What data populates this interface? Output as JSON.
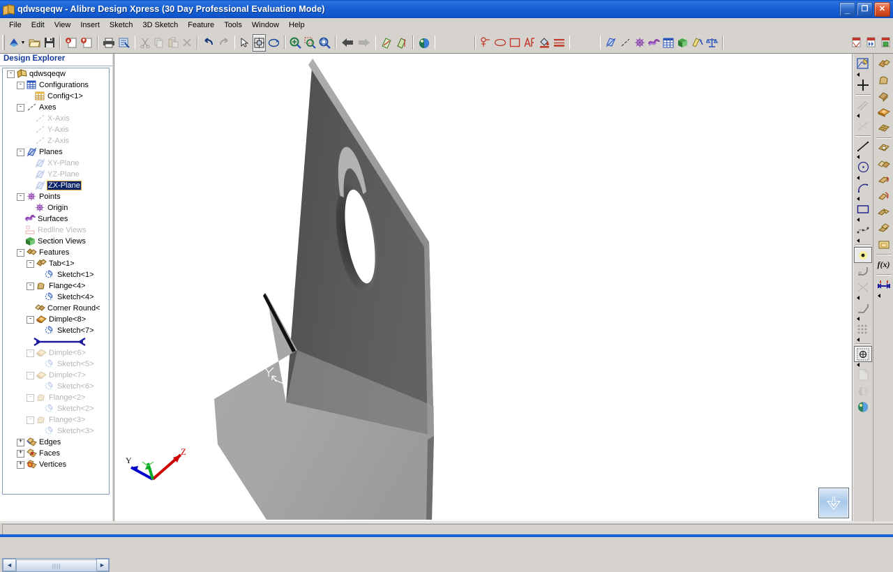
{
  "window": {
    "title": "qdwsqeqw - Alibre Design Xpress (30 Day Professional Evaluation Mode)",
    "app_icon": "part-document-icon",
    "minimize_label": "_",
    "restore_label": "❐",
    "close_label": "✕"
  },
  "menu": {
    "items": [
      {
        "label": "File"
      },
      {
        "label": "Edit"
      },
      {
        "label": "View"
      },
      {
        "label": "Insert"
      },
      {
        "label": "Sketch"
      },
      {
        "label": "3D Sketch"
      },
      {
        "label": "Feature"
      },
      {
        "label": "Tools"
      },
      {
        "label": "Window"
      },
      {
        "label": "Help"
      }
    ]
  },
  "toolbar": {
    "groups": [
      {
        "name": "file",
        "buttons": [
          {
            "icon": "new-document-icon",
            "label": "New",
            "dropdown": true
          },
          {
            "icon": "open-folder-icon",
            "label": "Open"
          },
          {
            "icon": "save-disk-icon",
            "label": "Save"
          }
        ]
      },
      {
        "name": "pack",
        "buttons": [
          {
            "icon": "pack-in-icon",
            "label": "Insert Package"
          },
          {
            "icon": "pack-out-icon",
            "label": "Extract Package"
          }
        ]
      },
      {
        "name": "print",
        "buttons": [
          {
            "icon": "print-icon",
            "label": "Print"
          },
          {
            "icon": "print-preview-icon",
            "label": "Print Preview"
          }
        ]
      },
      {
        "name": "clipboard",
        "buttons": [
          {
            "icon": "cut-scissors-icon",
            "label": "Cut",
            "disabled": true
          },
          {
            "icon": "copy-icon",
            "label": "Copy",
            "disabled": true
          },
          {
            "icon": "paste-icon",
            "label": "Paste",
            "disabled": true
          },
          {
            "icon": "delete-x-icon",
            "label": "Delete",
            "disabled": true
          }
        ]
      },
      {
        "name": "history",
        "buttons": [
          {
            "icon": "undo-arrow-icon",
            "label": "Undo"
          },
          {
            "icon": "redo-arrow-icon",
            "label": "Redo",
            "disabled": true
          }
        ]
      },
      {
        "name": "navigate",
        "buttons": [
          {
            "icon": "select-arrow-icon",
            "label": "Select"
          },
          {
            "icon": "pan-hand-icon",
            "label": "Pan",
            "active": true
          },
          {
            "icon": "rotate-icon",
            "label": "Rotate"
          }
        ]
      },
      {
        "name": "zoom",
        "buttons": [
          {
            "icon": "zoom-in-icon",
            "label": "Zoom In"
          },
          {
            "icon": "zoom-window-icon",
            "label": "Zoom Window"
          },
          {
            "icon": "zoom-fit-icon",
            "label": "Zoom To Fit"
          }
        ]
      },
      {
        "name": "view-history",
        "buttons": [
          {
            "icon": "previous-view-arrow-icon",
            "label": "Previous View"
          },
          {
            "icon": "next-view-arrow-icon",
            "label": "Next View",
            "disabled": true
          }
        ]
      },
      {
        "name": "display",
        "buttons": [
          {
            "icon": "sheet-metal-flat-icon",
            "label": "Flat Pattern"
          },
          {
            "icon": "sheet-metal-folded-icon",
            "label": "Folded Model"
          },
          {
            "icon": "render-globe-icon",
            "label": "Render Shading"
          }
        ]
      },
      {
        "name": "annotation",
        "buttons": [
          {
            "icon": "note-leader-icon",
            "label": "Note"
          },
          {
            "icon": "ellipse-annotation-icon",
            "label": "Ellipse"
          },
          {
            "icon": "rectangle-annotation-icon",
            "label": "Rectangle"
          },
          {
            "icon": "text-annotation-icon",
            "label": "Text"
          },
          {
            "icon": "fill-bucket-icon",
            "label": "Fill"
          },
          {
            "icon": "line-style-icon",
            "label": "Line Style"
          }
        ]
      },
      {
        "name": "reference",
        "buttons": [
          {
            "icon": "show-planes-icon",
            "label": "Show Planes"
          },
          {
            "icon": "show-axes-icon",
            "label": "Show Axes"
          },
          {
            "icon": "show-points-icon",
            "label": "Show Points"
          },
          {
            "icon": "show-surfaces-icon",
            "label": "Show Surfaces"
          },
          {
            "icon": "configurations-icon",
            "label": "Configurations"
          },
          {
            "icon": "section-view-icon",
            "label": "Section View"
          },
          {
            "icon": "measure-icon",
            "label": "Measure"
          },
          {
            "icon": "physical-properties-icon",
            "label": "Physical Properties"
          }
        ]
      },
      {
        "name": "publish",
        "buttons": [
          {
            "icon": "export-pdf-icon",
            "label": "Export PDF"
          },
          {
            "icon": "publish-3d-icon",
            "label": "Publish 3D"
          },
          {
            "icon": "capture-image-icon",
            "label": "Capture Image"
          }
        ]
      }
    ]
  },
  "explorer": {
    "header": "Design Explorer",
    "tree": [
      {
        "label": "qdwsqeqw",
        "depth": 0,
        "toggle": "-",
        "icon": "part-icon",
        "dim": false
      },
      {
        "label": "Configurations",
        "depth": 1,
        "toggle": "-",
        "icon": "configurations-icon",
        "dim": false
      },
      {
        "label": "Config<1>",
        "depth": 2,
        "toggle": "",
        "icon": "configuration-icon",
        "dim": false
      },
      {
        "label": "Axes",
        "depth": 1,
        "toggle": "-",
        "icon": "axis-icon",
        "dim": false
      },
      {
        "label": "X-Axis",
        "depth": 2,
        "toggle": "",
        "icon": "axis-icon",
        "dim": true
      },
      {
        "label": "Y-Axis",
        "depth": 2,
        "toggle": "",
        "icon": "axis-icon",
        "dim": true
      },
      {
        "label": "Z-Axis",
        "depth": 2,
        "toggle": "",
        "icon": "axis-icon",
        "dim": true
      },
      {
        "label": "Planes",
        "depth": 1,
        "toggle": "-",
        "icon": "plane-icon",
        "dim": false
      },
      {
        "label": "XY-Plane",
        "depth": 2,
        "toggle": "",
        "icon": "plane-icon",
        "dim": true
      },
      {
        "label": "YZ-Plane",
        "depth": 2,
        "toggle": "",
        "icon": "plane-icon",
        "dim": true
      },
      {
        "label": "ZX-Plane",
        "depth": 2,
        "toggle": "",
        "icon": "plane-icon",
        "dim": true,
        "selected": true
      },
      {
        "label": "Points",
        "depth": 1,
        "toggle": "-",
        "icon": "point-icon",
        "dim": false
      },
      {
        "label": "Origin",
        "depth": 2,
        "toggle": "",
        "icon": "point-icon",
        "dim": false
      },
      {
        "label": "Surfaces",
        "depth": 1,
        "toggle": "",
        "icon": "surfaces-icon",
        "dim": false
      },
      {
        "label": "Redline Views",
        "depth": 1,
        "toggle": "",
        "icon": "redline-icon",
        "dim": true
      },
      {
        "label": "Section Views",
        "depth": 1,
        "toggle": "",
        "icon": "section-view-icon",
        "dim": false
      },
      {
        "label": "Features",
        "depth": 1,
        "toggle": "-",
        "icon": "features-icon",
        "dim": false
      },
      {
        "label": "Tab<1>",
        "depth": 2,
        "toggle": "-",
        "icon": "tab-feature-icon",
        "dim": false
      },
      {
        "label": "Sketch<1>",
        "depth": 3,
        "toggle": "",
        "icon": "sketch-icon",
        "dim": false
      },
      {
        "label": "Flange<4>",
        "depth": 2,
        "toggle": "-",
        "icon": "flange-icon",
        "dim": false
      },
      {
        "label": "Sketch<4>",
        "depth": 3,
        "toggle": "",
        "icon": "sketch-icon",
        "dim": false
      },
      {
        "label": "Corner Round<",
        "depth": 2,
        "toggle": "",
        "icon": "corner-round-icon",
        "dim": false
      },
      {
        "label": "Dimple<8>",
        "depth": 2,
        "toggle": "-",
        "icon": "dimple-icon",
        "dim": false
      },
      {
        "label": "Sketch<7>",
        "depth": 3,
        "toggle": "",
        "icon": "sketch-icon",
        "dim": false
      },
      {
        "label": "__ROLLBACK__",
        "depth": 0,
        "toggle": "",
        "icon": "rollback-bar-icon",
        "dim": false
      },
      {
        "label": "Dimple<6>",
        "depth": 2,
        "toggle": "-",
        "icon": "dimple-icon",
        "dim": true
      },
      {
        "label": "Sketch<5>",
        "depth": 3,
        "toggle": "",
        "icon": "sketch-icon",
        "dim": true
      },
      {
        "label": "Dimple<7>",
        "depth": 2,
        "toggle": "-",
        "icon": "dimple-icon",
        "dim": true
      },
      {
        "label": "Sketch<6>",
        "depth": 3,
        "toggle": "",
        "icon": "sketch-icon",
        "dim": true
      },
      {
        "label": "Flange<2>",
        "depth": 2,
        "toggle": "-",
        "icon": "flange-icon",
        "dim": true
      },
      {
        "label": "Sketch<2>",
        "depth": 3,
        "toggle": "",
        "icon": "sketch-icon",
        "dim": true
      },
      {
        "label": "Flange<3>",
        "depth": 2,
        "toggle": "-",
        "icon": "flange-icon",
        "dim": true
      },
      {
        "label": "Sketch<3>",
        "depth": 3,
        "toggle": "",
        "icon": "sketch-icon",
        "dim": true
      },
      {
        "label": "Edges",
        "depth": 1,
        "toggle": "+",
        "icon": "edges-icon",
        "dim": false
      },
      {
        "label": "Faces",
        "depth": 1,
        "toggle": "+",
        "icon": "faces-icon",
        "dim": false
      },
      {
        "label": "Vertices",
        "depth": 1,
        "toggle": "+",
        "icon": "vertices-icon",
        "dim": false
      }
    ],
    "scroll": {
      "left_label": "◄",
      "right_label": "►",
      "grip": "||||"
    }
  },
  "viewport": {
    "triad": {
      "x_label": "",
      "y_label": "Y",
      "z_label": "Z"
    },
    "nav_button_icon": "down-arrow-icon",
    "model": {
      "name": "sheet-metal-part",
      "upper_face_color": "#585858",
      "upper_edge_color": "#9a9a9a",
      "lower_face_color": "#a8a8a8",
      "side_face_color": "#6f6f6f",
      "background": "#ffffff"
    }
  },
  "sketch_toolbar": {
    "name": "sketch-tools",
    "buttons": [
      {
        "icon": "activate-sketch-icon",
        "label": "Activate 2D Sketch",
        "flyout": true
      },
      {
        "icon": "reference-point-icon",
        "label": "Reference Point"
      },
      {
        "icon": "parallel-lines-icon",
        "label": "Offset",
        "disabled": true,
        "flyout": true
      },
      {
        "icon": "mirror-sketch-icon",
        "label": "Mirror",
        "disabled": true
      },
      {
        "icon": "line-icon",
        "label": "Line",
        "flyout": true
      },
      {
        "icon": "circle-icon",
        "label": "Circle",
        "flyout": true
      },
      {
        "icon": "arc-icon",
        "label": "Arc",
        "flyout": true
      },
      {
        "icon": "rectangle-icon",
        "label": "Rectangle",
        "flyout": true
      },
      {
        "icon": "spline-icon",
        "label": "Spline",
        "flyout": true
      },
      {
        "icon": "point-highlight-icon",
        "label": "Point",
        "active": true
      },
      {
        "icon": "fillet-sketch-icon",
        "label": "Sketch Fillet"
      },
      {
        "icon": "trim-icon",
        "label": "Trim",
        "disabled": true,
        "flyout": true
      },
      {
        "icon": "chamfer-sketch-icon",
        "label": "Sketch Chamfer",
        "flyout": true
      },
      {
        "icon": "pattern-icon",
        "label": "Pattern",
        "flyout": true
      },
      {
        "icon": "constraint-icon",
        "label": "Constraints",
        "active": true,
        "flyout": true
      },
      {
        "icon": "sheet-icon",
        "label": "New Sheet",
        "disabled": true
      },
      {
        "icon": "unfold-icon",
        "label": "Unfold",
        "disabled": true
      },
      {
        "icon": "render-globe-icon",
        "label": "Render"
      }
    ]
  },
  "feature_toolbar": {
    "name": "feature-tools",
    "buttons": [
      {
        "icon": "tab-feature-icon",
        "label": "Tab"
      },
      {
        "icon": "flange-icon",
        "label": "Flange"
      },
      {
        "icon": "bend-icon",
        "label": "Bend"
      },
      {
        "icon": "dimple-icon",
        "label": "Dimple"
      },
      {
        "icon": "louver-icon",
        "label": "Louver"
      },
      {
        "icon": "cut-feature-icon",
        "label": "Cut"
      },
      {
        "icon": "corner-round-icon",
        "label": "Corner Round"
      },
      {
        "icon": "hem-icon",
        "label": "Hem"
      },
      {
        "icon": "fold-icon",
        "label": "Fold"
      },
      {
        "icon": "unbend-icon",
        "label": "Unbend"
      },
      {
        "icon": "rebend-icon",
        "label": "Rebend"
      },
      {
        "icon": "flat-pattern-icon",
        "label": "Flat Pattern"
      },
      {
        "icon": "equation-icon",
        "label": "Equation Editor",
        "text": "f(x)"
      },
      {
        "icon": "dimension-icon",
        "label": "Dimension",
        "flyout": true
      }
    ]
  },
  "statusbar": {
    "message": ""
  }
}
